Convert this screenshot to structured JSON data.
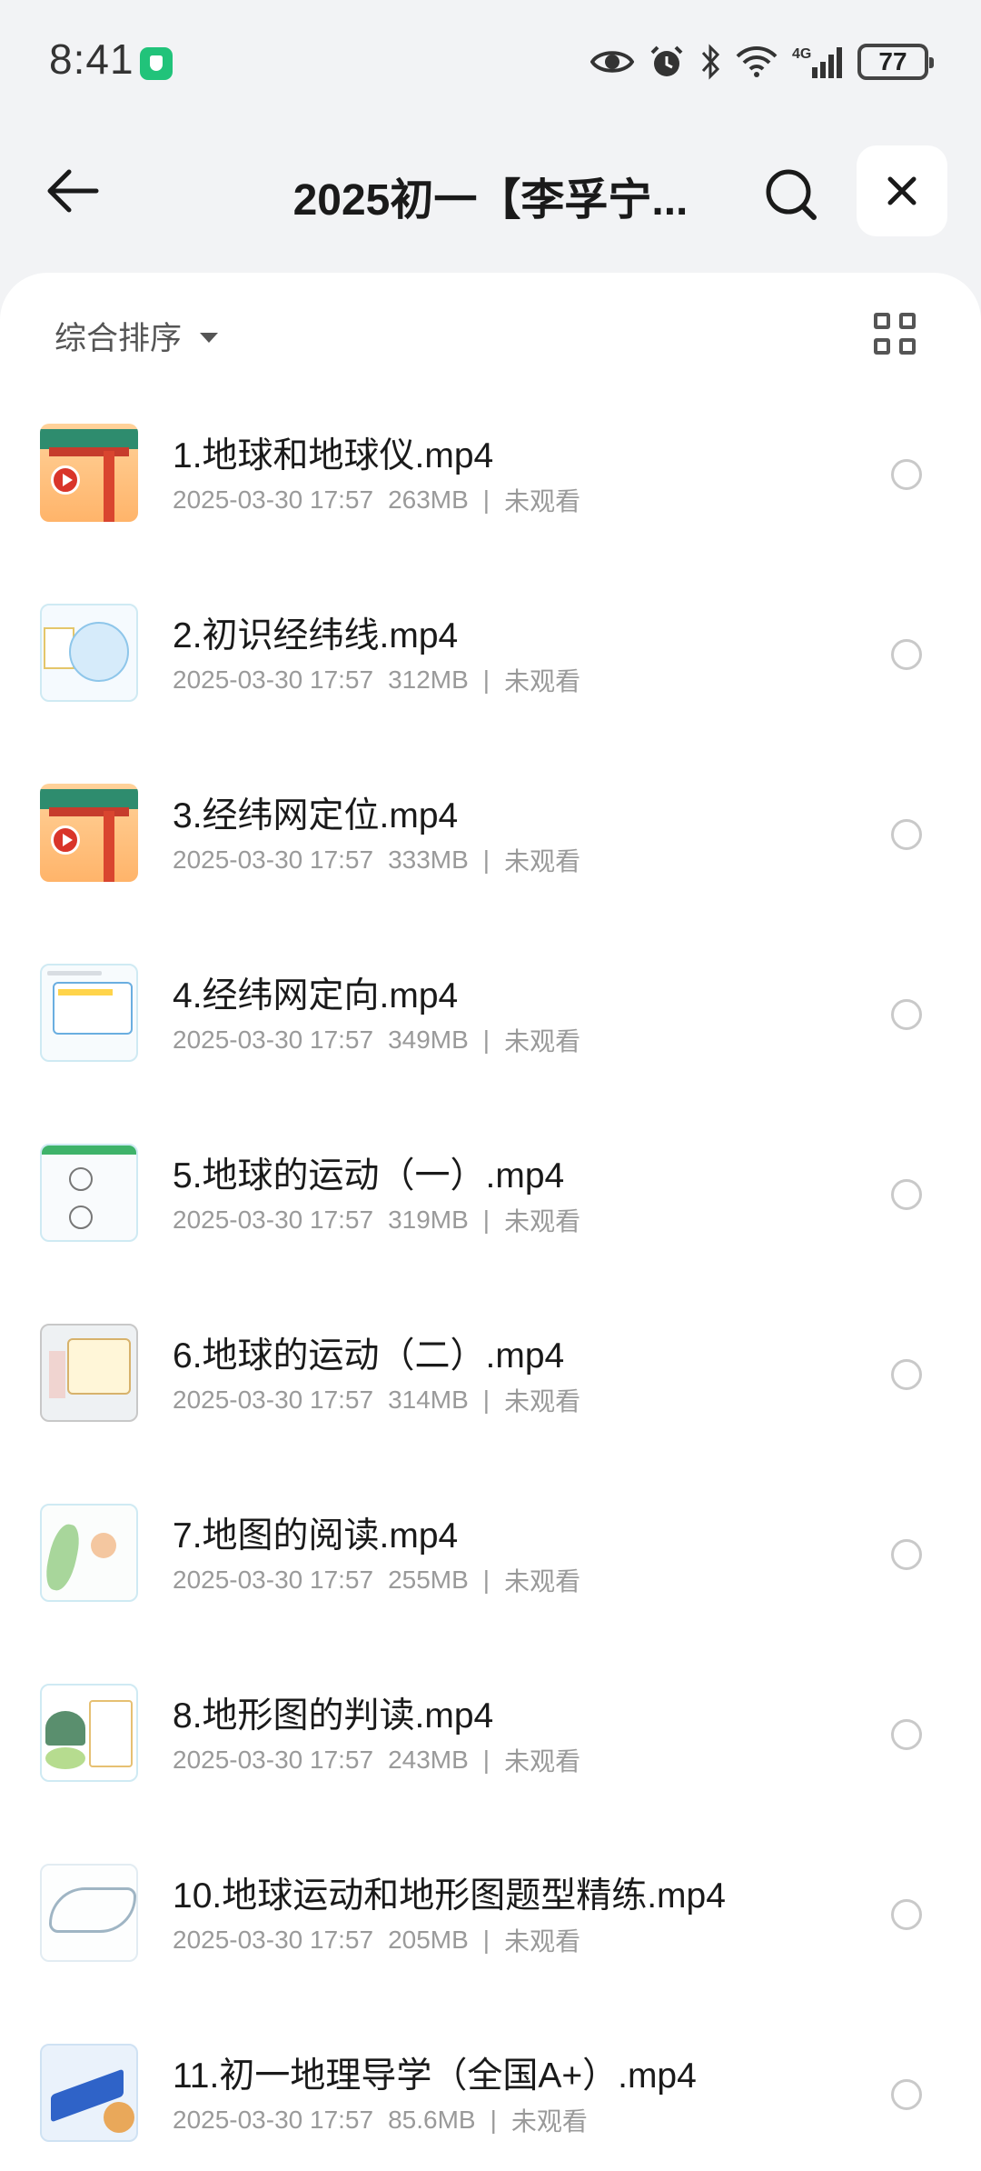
{
  "status_bar": {
    "time": "8:41",
    "icons": [
      "eye-icon",
      "alarm-icon",
      "bluetooth-icon",
      "wifi-icon",
      "signal-4g-icon"
    ],
    "network_label": "4G",
    "battery": "77"
  },
  "header": {
    "title": "2025初一【李孚宁...",
    "back_icon": "arrow-left-icon",
    "search_icon": "search-icon",
    "close_icon": "close-icon"
  },
  "toolbar": {
    "sort_label": "综合排序",
    "view_icon": "grid-view-icon"
  },
  "files": [
    {
      "name": "1.地球和地球仪.mp4",
      "date": "2025-03-30 17:57",
      "size": "263MB",
      "status": "未观看",
      "thumb": "gate"
    },
    {
      "name": "2.初识经纬线.mp4",
      "date": "2025-03-30 17:57",
      "size": "312MB",
      "status": "未观看",
      "thumb": "globe"
    },
    {
      "name": "3.经纬网定位.mp4",
      "date": "2025-03-30 17:57",
      "size": "333MB",
      "status": "未观看",
      "thumb": "gate"
    },
    {
      "name": "4.经纬网定向.mp4",
      "date": "2025-03-30 17:57",
      "size": "349MB",
      "status": "未观看",
      "thumb": "slide"
    },
    {
      "name": "5.地球的运动（一）.mp4",
      "date": "2025-03-30 17:57",
      "size": "319MB",
      "status": "未观看",
      "thumb": "cosmos"
    },
    {
      "name": "6.地球的运动（二）.mp4",
      "date": "2025-03-30 17:57",
      "size": "314MB",
      "status": "未观看",
      "thumb": "note"
    },
    {
      "name": "7.地图的阅读.mp4",
      "date": "2025-03-30 17:57",
      "size": "255MB",
      "status": "未观看",
      "thumb": "taiwan"
    },
    {
      "name": "8.地形图的判读.mp4",
      "date": "2025-03-30 17:57",
      "size": "243MB",
      "status": "未观看",
      "thumb": "terrain"
    },
    {
      "name": "10.地球运动和地形图题型精练.mp4",
      "date": "2025-03-30 17:57",
      "size": "205MB",
      "status": "未观看",
      "thumb": "river"
    },
    {
      "name": "11.初一地理导学（全国A+）.mp4",
      "date": "2025-03-30 17:57",
      "size": "85.6MB",
      "status": "未观看",
      "thumb": "chart"
    }
  ]
}
